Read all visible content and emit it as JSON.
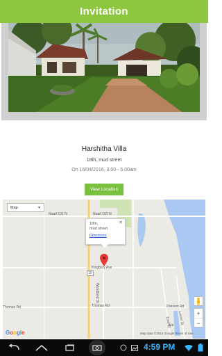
{
  "app_bar": {
    "title": "Invitation"
  },
  "villa": {
    "name": "Harshitha Villa",
    "address": "18th, mud street",
    "date": "On 16/04/2016, 3.00 - 5.00am"
  },
  "view_location_button": "View Location",
  "map": {
    "type_selector": "Map",
    "info_window": {
      "line1": "18th,",
      "line2": "mud street",
      "directions": "Directions"
    },
    "roads": {
      "road_101": "Road 101 N",
      "road_102": "Road 102 N",
      "kingbury": "Kingbury Ave",
      "woodland": "Woodland St",
      "thomas_left": "Thomas Rd",
      "thomas_mid": "Thomas Rd",
      "division": "Division Rd",
      "hwy_route": "10",
      "ave": "Ave",
      "east_st": "East St",
      "laurel": "Laurel St"
    },
    "zoom_in": "+",
    "zoom_out": "−",
    "google_logo": [
      "G",
      "o",
      "o",
      "g",
      "l",
      "e"
    ],
    "attribution": "Map data ©2016 Google   Terms of Use"
  },
  "status_bar": {
    "time": "4:59 PM"
  },
  "colors": {
    "accent": "#8dc63f",
    "button": "#7ac142",
    "water": "#a9c9f3",
    "clock": "#38b6ff"
  }
}
